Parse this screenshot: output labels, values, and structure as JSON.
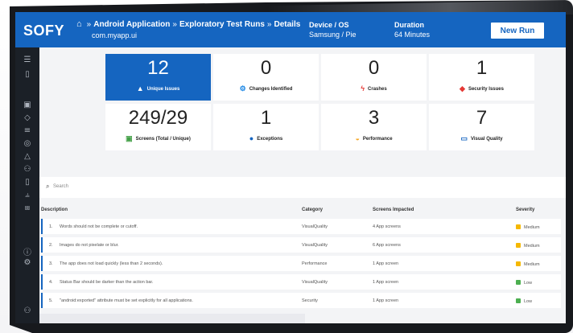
{
  "header": {
    "logo": "SOFY",
    "breadcrumb": [
      "Android Application",
      "Exploratory Test Runs",
      "Details"
    ],
    "package": "com.myapp.ui",
    "device_label": "Device / OS",
    "device_value": "Samsung / Pie",
    "duration_label": "Duration",
    "duration_value": "64 Minutes",
    "new_run": "New Run"
  },
  "tiles": [
    {
      "value": "12",
      "label": "Unique Issues"
    },
    {
      "value": "0",
      "label": "Changes Identified"
    },
    {
      "value": "0",
      "label": "Crashes"
    },
    {
      "value": "1",
      "label": "Security Issues"
    },
    {
      "value": "249/29",
      "label": "Screens (Total / Unique)"
    },
    {
      "value": "1",
      "label": "Exceptions"
    },
    {
      "value": "3",
      "label": "Performance"
    },
    {
      "value": "7",
      "label": "Visual Quality"
    }
  ],
  "search": {
    "placeholder": "Search"
  },
  "table": {
    "headers": [
      "Description",
      "Category",
      "Screens Impacted",
      "Severity"
    ],
    "rows": [
      {
        "num": "1.",
        "description": "Words should not be complete or cutoff.",
        "category": "VisualQuality",
        "screens": "4 App screens",
        "severity": "Medium"
      },
      {
        "num": "2.",
        "description": "Images do not pixelate or blur.",
        "category": "VisualQuality",
        "screens": "6 App screens",
        "severity": "Medium"
      },
      {
        "num": "3.",
        "description": "The app does not load quickly (less than 2 seconds).",
        "category": "Performance",
        "screens": "1 App screen",
        "severity": "Medium"
      },
      {
        "num": "4.",
        "description": "Status Bar should be darker than the action bar.",
        "category": "VisualQuality",
        "screens": "1 App screen",
        "severity": "Low"
      },
      {
        "num": "5.",
        "description": "\"android:exported\" attribute must be set explicitly for all applications.",
        "category": "Security",
        "screens": "1 App screen",
        "severity": "Low"
      }
    ]
  },
  "colors": {
    "brand": "#1565c0",
    "medium": "#f5b800",
    "low": "#4caf50"
  }
}
